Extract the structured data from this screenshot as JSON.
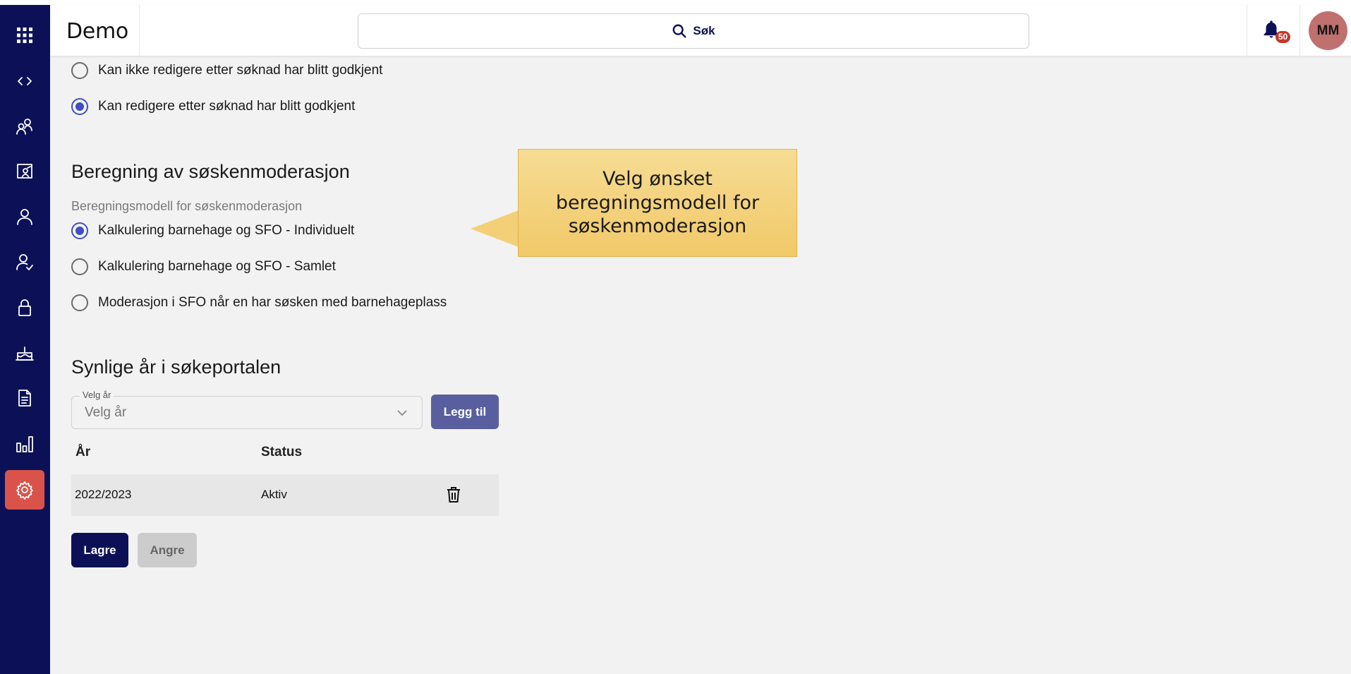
{
  "header": {
    "app_title": "Demo",
    "search_label": "Søk",
    "notification_count": "50",
    "avatar_initials": "MM"
  },
  "sidebar": {
    "items": [
      {
        "icon": "apps-grid-icon"
      },
      {
        "icon": "code-icon"
      },
      {
        "icon": "people-network-icon"
      },
      {
        "icon": "presentation-people-icon"
      },
      {
        "icon": "user-icon"
      },
      {
        "icon": "user-check-icon"
      },
      {
        "icon": "lock-icon"
      },
      {
        "icon": "cake-icon"
      },
      {
        "icon": "document-icon"
      },
      {
        "icon": "bar-chart-icon"
      },
      {
        "icon": "gear-icon",
        "active": true
      }
    ],
    "active_color": "#d9534a",
    "background_color": "#0c1157"
  },
  "edit_options": [
    {
      "label": "Kan ikke redigere etter søknad har blitt godkjent",
      "checked": false
    },
    {
      "label": "Kan redigere etter søknad har blitt godkjent",
      "checked": true
    }
  ],
  "sibling_section": {
    "title": "Beregning av søskenmoderasjon",
    "field_label": "Beregningsmodell for søskenmoderasjon",
    "options": [
      {
        "label": "Kalkulering barnehage og SFO - Individuelt",
        "checked": true
      },
      {
        "label": "Kalkulering barnehage og SFO - Samlet",
        "checked": false
      },
      {
        "label": "Moderasjon i SFO når en har søsken med barnehageplass",
        "checked": false
      }
    ]
  },
  "callout": {
    "text": "Velg ønsket beregningsmodell for søskenmoderasjon"
  },
  "years_section": {
    "title": "Synlige år i søkeportalen",
    "select_legend": "Velg år",
    "select_placeholder": "Velg år",
    "add_button": "Legg til",
    "columns": [
      "År",
      "Status"
    ],
    "rows": [
      {
        "year": "2022/2023",
        "status": "Aktiv"
      }
    ]
  },
  "actions": {
    "save": "Lagre",
    "undo": "Angre"
  }
}
